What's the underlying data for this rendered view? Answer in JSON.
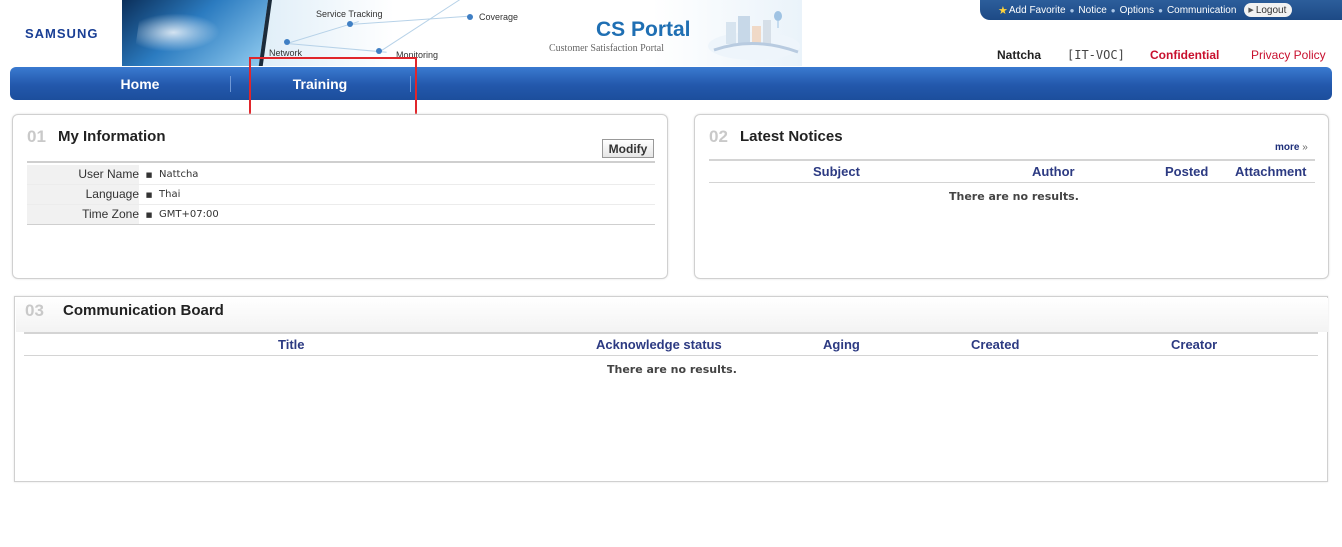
{
  "header": {
    "brand": "SAMSUNG",
    "portal_title": "CS Portal",
    "portal_subtitle": "Customer Satisfaction Portal",
    "network_labels": [
      "Service Tracking",
      "Coverage",
      "Network",
      "Monitoring"
    ],
    "top_links": {
      "add_favorite": "Add Favorite",
      "notice": "Notice",
      "options": "Options",
      "communication": "Communication",
      "logout": "Logout"
    },
    "user_name": "Nattcha",
    "user_dept": "[IT-VOC]",
    "confidential": "Confidential",
    "privacy_policy": "Privacy Policy"
  },
  "nav": {
    "home": "Home",
    "training": "Training"
  },
  "my_info": {
    "number": "01",
    "title": "My Information",
    "modify_label": "Modify",
    "rows": [
      {
        "label": "User Name",
        "value": "Nattcha"
      },
      {
        "label": "Language",
        "value": "Thai"
      },
      {
        "label": "Time Zone",
        "value": "GMT+07:00"
      }
    ]
  },
  "notices": {
    "number": "02",
    "title": "Latest Notices",
    "more_label": "more",
    "columns": [
      "Subject",
      "Author",
      "Posted",
      "Attachment"
    ],
    "empty_text": "There are no results."
  },
  "board": {
    "number": "03",
    "title": "Communication Board",
    "columns": [
      "Title",
      "Acknowledge status",
      "Aging",
      "Created",
      "Creator"
    ],
    "empty_text": "There are no results."
  },
  "colors": {
    "nav_blue": "#2358ac",
    "header_text": "#2c3a82",
    "confidential_red": "#c8102e",
    "annotation_red": "#e0262b"
  }
}
